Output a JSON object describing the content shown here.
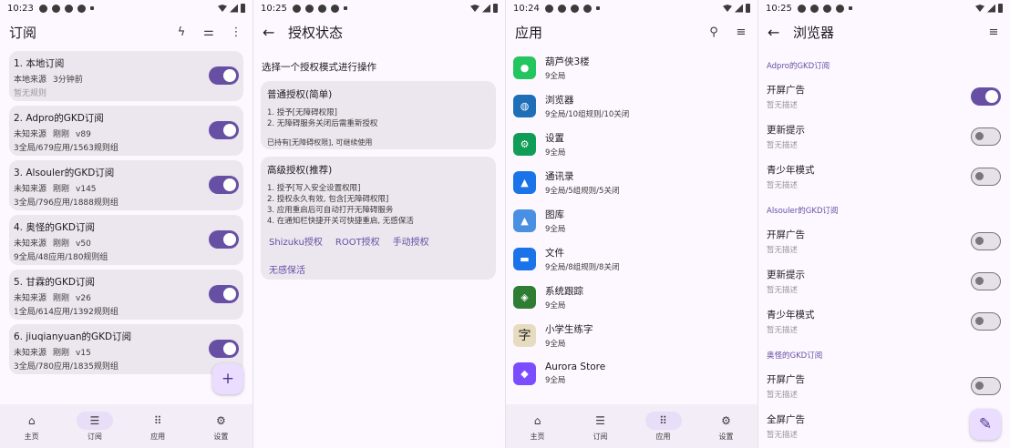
{
  "screens": {
    "s1": {
      "status": {
        "time": "10:23"
      },
      "title": "订阅",
      "icons": {
        "update": "flash-icon",
        "filter": "tune-icon",
        "more": "more-vert-icon"
      },
      "cards": [
        {
          "name": "1. 本地订阅",
          "source": "本地来源",
          "time": "3分钟前",
          "version": "",
          "info": "暂无规则",
          "enabled": true
        },
        {
          "name": "2. Adpro的GKD订阅",
          "source": "未知来源",
          "time": "刚刚",
          "version": "v89",
          "info": "3全局/679应用/1563规则组",
          "enabled": true
        },
        {
          "name": "3. Alsouler的GKD订阅",
          "source": "未知来源",
          "time": "刚刚",
          "version": "v145",
          "info": "3全局/796应用/1888规则组",
          "enabled": true
        },
        {
          "name": "4. 奥怪的GKD订阅",
          "source": "未知来源",
          "time": "刚刚",
          "version": "v50",
          "info": "9全局/48应用/180规则组",
          "enabled": true
        },
        {
          "name": "5. 甘霖的GKD订阅",
          "source": "未知来源",
          "time": "刚刚",
          "version": "v26",
          "info": "1全局/614应用/1392规则组",
          "enabled": true
        },
        {
          "name": "6. jiuqianyuan的GKD订阅",
          "source": "未知来源",
          "time": "刚刚",
          "version": "v15",
          "info": "3全局/780应用/1835规则组",
          "enabled": true
        }
      ],
      "fab": "+",
      "nav": [
        {
          "label": "主页",
          "icon": "home-icon",
          "active": false
        },
        {
          "label": "订阅",
          "icon": "list-icon",
          "active": true
        },
        {
          "label": "应用",
          "icon": "apps-icon",
          "active": false
        },
        {
          "label": "设置",
          "icon": "gear-icon",
          "active": false
        }
      ]
    },
    "s2": {
      "status": {
        "time": "10:25"
      },
      "title": "授权状态",
      "prompt": "选择一个授权模式进行操作",
      "basic": {
        "heading": "普通授权(简单)",
        "lines": [
          "1. 授予[无障碍权限]",
          "2. 无障碍服务关闭后需重新授权"
        ],
        "note": "已持有[无障碍权限], 可继续使用"
      },
      "advanced": {
        "heading": "高级授权(推荐)",
        "lines": [
          "1. 授予[写入安全设置权限]",
          "2. 授权永久有效, 包含[无障碍权限]",
          "3. 应用重启后可自动打开无障碍服务",
          "4. 在通知栏快捷开关可快捷重启, 无感保活"
        ],
        "buttons": [
          "Shizuku授权",
          "ROOT授权",
          "手动授权"
        ],
        "extra": "无感保活"
      }
    },
    "s3": {
      "status": {
        "time": "10:24"
      },
      "title": "应用",
      "apps": [
        {
          "name": "葫芦侠3楼",
          "desc": "9全局",
          "color": "#22c55e",
          "icon": "chat-bubble-icon"
        },
        {
          "name": "浏览器",
          "desc": "9全局/10组规则/10关闭",
          "color": "#1e6fb8",
          "icon": "globe-icon"
        },
        {
          "name": "设置",
          "desc": "9全局",
          "color": "#0f9d58",
          "icon": "gear-icon"
        },
        {
          "name": "通讯录",
          "desc": "9全局/5组规则/5关闭",
          "color": "#1a73e8",
          "icon": "contacts-icon"
        },
        {
          "name": "图库",
          "desc": "9全局",
          "color": "#4a90e2",
          "icon": "gallery-icon"
        },
        {
          "name": "文件",
          "desc": "9全局/8组规则/8关闭",
          "color": "#1a73e8",
          "icon": "folder-icon"
        },
        {
          "name": "系统跟踪",
          "desc": "9全局",
          "color": "#2e7d32",
          "icon": "android-icon"
        },
        {
          "name": "小学生练字",
          "desc": "9全局",
          "color": "#e8dcc0",
          "icon": "character-icon",
          "glyph": "字"
        },
        {
          "name": "Aurora Store",
          "desc": "9全局",
          "color": "#7c4dff",
          "icon": "store-icon"
        }
      ],
      "nav": [
        {
          "label": "主页",
          "icon": "home-icon",
          "active": false
        },
        {
          "label": "订阅",
          "icon": "list-icon",
          "active": false
        },
        {
          "label": "应用",
          "icon": "apps-icon",
          "active": true
        },
        {
          "label": "设置",
          "icon": "gear-icon",
          "active": false
        }
      ]
    },
    "s4": {
      "status": {
        "time": "10:25"
      },
      "title": "浏览器",
      "groups": [
        {
          "name": "Adpro的GKD订阅",
          "rules": [
            {
              "name": "开屏广告",
              "desc": "暂无描述",
              "enabled": true
            },
            {
              "name": "更新提示",
              "desc": "暂无描述",
              "enabled": false
            },
            {
              "name": "青少年模式",
              "desc": "暂无描述",
              "enabled": false
            }
          ]
        },
        {
          "name": "Alsouler的GKD订阅",
          "rules": [
            {
              "name": "开屏广告",
              "desc": "暂无描述",
              "enabled": false
            },
            {
              "name": "更新提示",
              "desc": "暂无描述",
              "enabled": false
            },
            {
              "name": "青少年模式",
              "desc": "暂无描述",
              "enabled": false
            }
          ]
        },
        {
          "name": "奥怪的GKD订阅",
          "rules": [
            {
              "name": "开屏广告",
              "desc": "暂无描述",
              "enabled": false
            },
            {
              "name": "全屏广告",
              "desc": "暂无描述",
              "enabled": false
            }
          ]
        }
      ],
      "fab_icon": "edit-icon"
    }
  },
  "colors": {
    "accent": "#6750a4",
    "card": "#ece6ee",
    "background": "#fdf7ff"
  }
}
